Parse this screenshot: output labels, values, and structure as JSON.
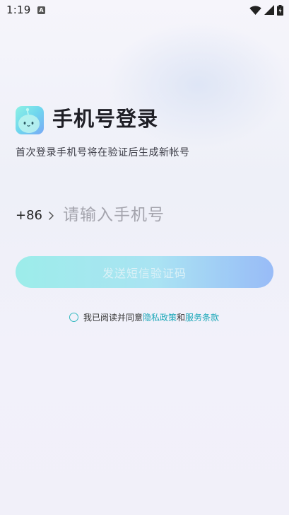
{
  "status_bar": {
    "time": "1:19",
    "notification_icon_letter": "A",
    "icons": [
      "wifi-icon",
      "signal-icon",
      "battery-icon"
    ]
  },
  "header": {
    "title": "手机号登录",
    "subtitle": "首次登录手机号将在验证后生成新帐号"
  },
  "phone": {
    "country_code": "+86",
    "placeholder": "请输入手机号",
    "value": ""
  },
  "actions": {
    "send_code_label": "发送短信验证码"
  },
  "agreement": {
    "prefix": "我已阅读并同意",
    "privacy_link": "隐私政策",
    "conjunction": "和",
    "terms_link": "服务条款",
    "checked": false
  },
  "colors": {
    "accent": "#1aa7b8",
    "button_start": "#93ece8",
    "button_end": "#8fb6f7",
    "logo_start": "#8ef2e4",
    "logo_end": "#78a8f6"
  }
}
